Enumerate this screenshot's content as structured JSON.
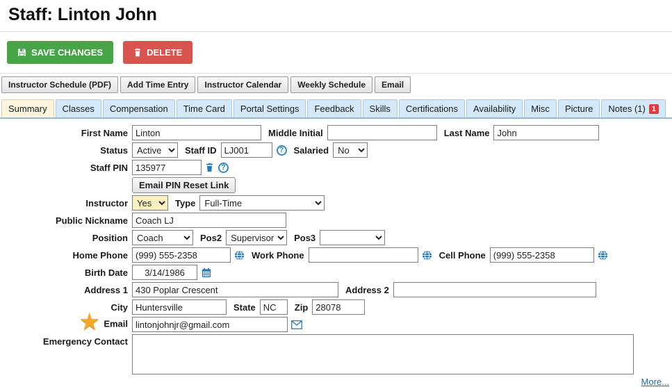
{
  "page": {
    "title": "Staff: Linton John"
  },
  "actions": {
    "save": "SAVE CHANGES",
    "delete": "DELETE"
  },
  "toolbar": {
    "buttons": [
      "Instructor Schedule (PDF)",
      "Add Time Entry",
      "Instructor Calendar",
      "Weekly Schedule",
      "Email"
    ]
  },
  "tabs": [
    {
      "label": "Summary",
      "active": true
    },
    {
      "label": "Classes"
    },
    {
      "label": "Compensation"
    },
    {
      "label": "Time Card"
    },
    {
      "label": "Portal Settings"
    },
    {
      "label": "Feedback"
    },
    {
      "label": "Skills"
    },
    {
      "label": "Certifications"
    },
    {
      "label": "Availability"
    },
    {
      "label": "Misc"
    },
    {
      "label": "Picture"
    },
    {
      "label": "Notes (1)",
      "badge": "1"
    }
  ],
  "form": {
    "first_name": {
      "label": "First Name",
      "value": "Linton"
    },
    "middle_initial": {
      "label": "Middle Initial",
      "value": ""
    },
    "last_name": {
      "label": "Last Name",
      "value": "John"
    },
    "status": {
      "label": "Status",
      "value": "Active"
    },
    "staff_id": {
      "label": "Staff ID",
      "value": "LJ001"
    },
    "salaried": {
      "label": "Salaried",
      "value": "No"
    },
    "staff_pin": {
      "label": "Staff PIN",
      "value": "135977"
    },
    "email_pin_button": "Email PIN Reset Link",
    "instructor": {
      "label": "Instructor",
      "value": "Yes"
    },
    "type": {
      "label": "Type",
      "value": "Full-Time"
    },
    "public_nickname": {
      "label": "Public Nickname",
      "value": "Coach LJ"
    },
    "position": {
      "label": "Position",
      "value": "Coach"
    },
    "pos2": {
      "label": "Pos2",
      "value": "Supervisor"
    },
    "pos3": {
      "label": "Pos3",
      "value": ""
    },
    "home_phone": {
      "label": "Home Phone",
      "value": "(999) 555-2358"
    },
    "work_phone": {
      "label": "Work Phone",
      "value": ""
    },
    "cell_phone": {
      "label": "Cell Phone",
      "value": "(999) 555-2358"
    },
    "birth_date": {
      "label": "Birth Date",
      "value": "3/14/1986"
    },
    "address1": {
      "label": "Address 1",
      "value": "430 Poplar Crescent"
    },
    "address2": {
      "label": "Address 2",
      "value": ""
    },
    "city": {
      "label": "City",
      "value": "Huntersville"
    },
    "state": {
      "label": "State",
      "value": "NC"
    },
    "zip": {
      "label": "Zip",
      "value": "28078"
    },
    "email": {
      "label": "Email",
      "value": "lintonjohnjr@gmail.com"
    },
    "emergency_contact": {
      "label": "Emergency Contact",
      "value": ""
    },
    "more_link": "More..."
  },
  "icons": {
    "question": "?",
    "star": "★"
  },
  "colors": {
    "save_button": "#47a447",
    "delete_button": "#d9534f",
    "highlight_field": "#fcefc0",
    "disabled_field": "#d6d6d6",
    "tab_background": "#d3e8f8",
    "active_tab_background": "#fdf5dd",
    "notes_badge": "#e23b3b",
    "icon_blue": "#2979b8",
    "link_blue": "#2268b2",
    "star_gold": "#f8a822"
  }
}
